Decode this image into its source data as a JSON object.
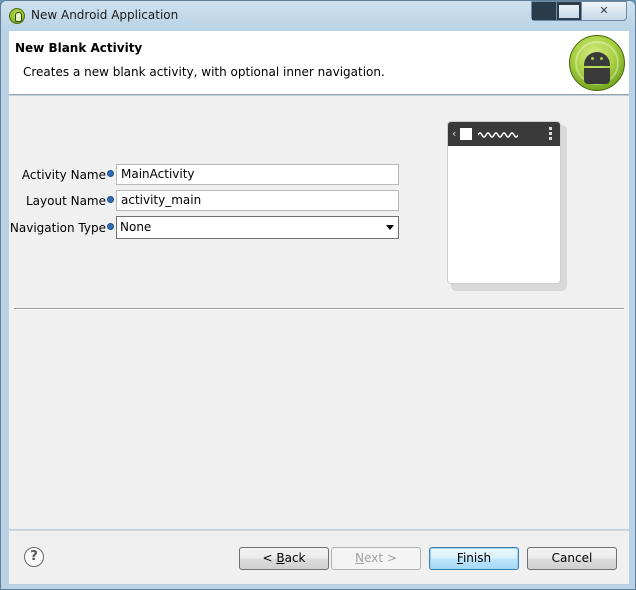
{
  "window": {
    "title": "New Android Application"
  },
  "header": {
    "title": "New Blank Activity",
    "description": "Creates a new blank activity, with optional inner navigation."
  },
  "form": {
    "activity_name": {
      "label": "Activity Name",
      "value": "MainActivity"
    },
    "layout_name": {
      "label": "Layout Name",
      "value": "activity_main"
    },
    "navigation_type": {
      "label": "Navigation Type",
      "value": "None"
    }
  },
  "footer": {
    "help": "?",
    "back": {
      "prefix": "< ",
      "mnemonic": "B",
      "rest": "ack"
    },
    "next": {
      "mnemonic": "N",
      "rest": "ext >"
    },
    "finish": {
      "mnemonic": "F",
      "rest": "inish"
    },
    "cancel": "Cancel"
  },
  "colors": {
    "frame": "#b9d2e5",
    "panel": "#f0f0f0",
    "android_green": "#a8d040",
    "default_button": "#3c7fb1"
  }
}
